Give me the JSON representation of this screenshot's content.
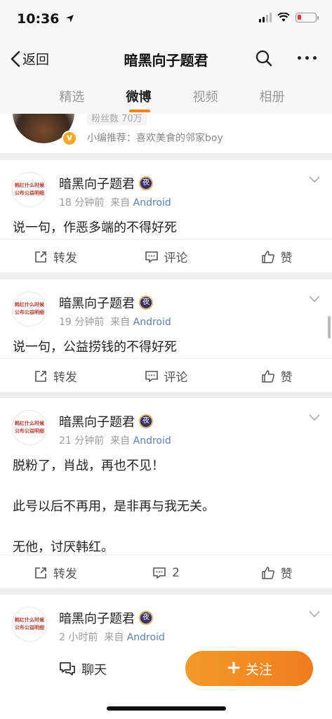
{
  "status": {
    "time": "10:36"
  },
  "nav": {
    "back_label": "返回",
    "title": "暗黑向子题君"
  },
  "tabs": [
    {
      "label": "精选"
    },
    {
      "label": "微博"
    },
    {
      "label": "视频"
    },
    {
      "label": "相册"
    }
  ],
  "profile": {
    "fans_text": "粉丝数 70万",
    "verified_mark": "v",
    "recommend": "小编推荐：喜欢美食的邻家boy"
  },
  "posts": [
    {
      "avatar_lines": [
        "韩红什么时候",
        "公布公益明细"
      ],
      "name": "暗黑向子题君",
      "badge": "夜",
      "time": "18 分钟前",
      "from_label": "来自",
      "source": "Android",
      "text": "说一句，作恶多端的不得好死",
      "repost_label": "转发",
      "comment_label": "评论",
      "like_label": "赞"
    },
    {
      "avatar_lines": [
        "韩红什么时候",
        "公布公益明细"
      ],
      "name": "暗黑向子题君",
      "badge": "夜",
      "time": "19 分钟前",
      "from_label": "来自",
      "source": "Android",
      "text": "说一句，公益捞钱的不得好死",
      "repost_label": "转发",
      "comment_label": "评论",
      "like_label": "赞"
    },
    {
      "avatar_lines": [
        "韩红什么时候",
        "公布公益明细"
      ],
      "name": "暗黑向子题君",
      "badge": "夜",
      "time": "21 分钟前",
      "from_label": "来自",
      "source": "Android",
      "text": "脱粉了，肖战，再也不见！\n\n此号以后不再用，是非再与我无关。\n\n无他，讨厌韩红。",
      "repost_label": "转发",
      "comment_label": "2",
      "like_label": "赞"
    },
    {
      "avatar_lines": [
        "韩红什么时候",
        "公布公益明细"
      ],
      "name": "暗黑向子题君",
      "badge": "夜",
      "time": "2 小时前",
      "from_label": "来自",
      "source": "Android"
    }
  ],
  "bottom": {
    "chat_label": "聊天",
    "follow_label": "关注",
    "follow_plus": "+"
  },
  "colors": {
    "accent": "#f2841b",
    "link": "#5b7fb5",
    "battery_low": "#e53935"
  },
  "icons": [
    "location-arrow-icon",
    "signal-icon",
    "wifi-icon",
    "battery-icon",
    "back-chevron-icon",
    "search-icon",
    "more-icon",
    "chevron-down-icon",
    "share-icon",
    "comment-icon",
    "like-icon",
    "chat-icon"
  ]
}
